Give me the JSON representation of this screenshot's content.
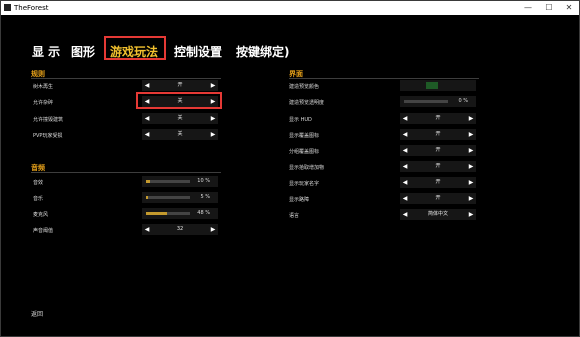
{
  "window": {
    "title": "TheForest",
    "minimize": "—",
    "maximize": "☐",
    "close": "✕"
  },
  "tabs": [
    {
      "label": "显 示"
    },
    {
      "label": "图形"
    },
    {
      "label": "游戏玩法"
    },
    {
      "label": "控制设置"
    },
    {
      "label": "按键绑定)"
    }
  ],
  "rules": {
    "title": "规则",
    "rows": [
      {
        "label": "树木再生",
        "value": "开"
      },
      {
        "label": "允许杂碎",
        "value": "关"
      },
      {
        "label": "允许撞毁建筑",
        "value": "关"
      },
      {
        "label": "PVP玩家受损",
        "value": "关"
      }
    ]
  },
  "audio": {
    "title": "音频",
    "rows": [
      {
        "label": "音效",
        "percent_text": "10 %",
        "level": 0.1
      },
      {
        "label": "音乐",
        "percent_text": "5 %",
        "level": 0.05
      },
      {
        "label": "麦克风",
        "percent_text": "48 %",
        "level": 0.48
      },
      {
        "label": "声音阈值",
        "value": "32"
      }
    ]
  },
  "ui_section": {
    "title": "界面",
    "rows": [
      {
        "label": "建造预览颜色"
      },
      {
        "label": "建造预览透明度",
        "percent_text": "0 %",
        "level": 0.0
      },
      {
        "label": "显示 HUD",
        "value": "开"
      },
      {
        "label": "显示覆盖图标",
        "value": "开"
      },
      {
        "label": "分组覆盖图标",
        "value": "开"
      },
      {
        "label": "显示拾取增加物",
        "value": "开"
      },
      {
        "label": "显示玩家名字",
        "value": "开"
      },
      {
        "label": "显示路障",
        "value": "开"
      },
      {
        "label": "语言",
        "value": "简体中文"
      }
    ]
  },
  "footer": {
    "back": "返回"
  },
  "colors": {
    "accent": "#f2c12e",
    "section": "#e8a21a",
    "highlight": "#e53935",
    "preview_swatch": "#1e5a26"
  }
}
